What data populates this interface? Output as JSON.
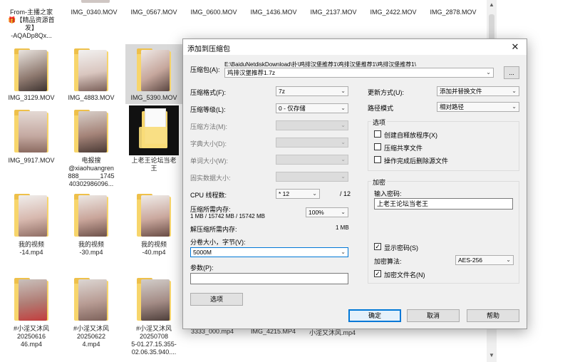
{
  "explorer": {
    "top_tiles": [
      {
        "label": "From-主播之家\n🎁【精品资源首发】\n-AQADp8Qx..."
      },
      {
        "label": "IMG_0340.MOV"
      },
      {
        "label": "IMG_0567.MOV"
      },
      {
        "label": "IMG_0600.MOV"
      },
      {
        "label": "IMG_1436.MOV"
      },
      {
        "label": "IMG_2137.MOV"
      },
      {
        "label": "IMG_2422.MOV"
      },
      {
        "label": "IMG_2878.MOV"
      }
    ],
    "row2": [
      {
        "label": "IMG_3129.MOV"
      },
      {
        "label": "IMG_4883.MOV"
      },
      {
        "label": "IMG_5390.MOV"
      }
    ],
    "row3": [
      {
        "label": "IMG_9917.MOV"
      },
      {
        "label": "电报搜\n@xiaohuangren\n888______1745\n40302986096..."
      },
      {
        "label": "上老王论坛当老\n王"
      }
    ],
    "row4": [
      {
        "label": "我的视频\n-14.mp4"
      },
      {
        "label": "我的视频\n-30.mp4"
      },
      {
        "label": "我的视频\n-40.mp4"
      }
    ],
    "row5": [
      {
        "label": "#小淫又沐风\n20250616\n46.mp4"
      },
      {
        "label": "#小淫又沐风\n20250622\n4.mp4"
      },
      {
        "label": "#小淫又沐风\n20250708\n5-01.27.15.355-\n02.06.35.940...."
      }
    ],
    "bottom_strip": [
      "3333_000.mp4",
      "IMG_4215.MP4",
      "小淫又沐风.mp4"
    ]
  },
  "dialog": {
    "title": "添加到压缩包",
    "close_glyph": "✕",
    "archive_label": "压缩包(A):",
    "archive_path": "E:\\BaiduNetdiskDownload\\扑\\鸡排汉堡推荐1\\鸡排汉堡推荐1\\鸡排汉堡推荐1\\",
    "archive_name": "鸡排汉堡推荐1.7z",
    "browse_label": "...",
    "format_label": "压缩格式(F):",
    "format_value": "7z",
    "level_label": "压缩等级(L):",
    "level_value": "0 - 仅存储",
    "method_label": "压缩方法(M):",
    "dict_label": "字典大小(D):",
    "word_label": "单词大小(W):",
    "solid_label": "固实数据大小:",
    "threads_label": "CPU 线程数:",
    "threads_value": "* 12",
    "threads_max": "/ 12",
    "mem_comp_label": "压缩所需内存:",
    "mem_comp_detail": "1 MB / 15742 MB / 15742 MB",
    "mem_comp_percent": "100%",
    "mem_decomp_label": "解压缩所需内存:",
    "mem_decomp_value": "1 MB",
    "split_label": "分卷大小，字节(V):",
    "split_value": "5000M",
    "params_label": "参数(P):",
    "params_value": "",
    "options_button": "选项",
    "update_label": "更新方式(U):",
    "update_value": "添加并替换文件",
    "path_label": "路径模式",
    "path_value": "相对路径",
    "options_group": "选项",
    "opt_sfx": "创建自释放程序(X)",
    "opt_shared": "压缩共享文件",
    "opt_delete": "操作完成后删除源文件",
    "enc_group": "加密",
    "enc_pwd_label": "输入密码:",
    "enc_pwd_value": "上老王论坛当老王",
    "enc_show": "显示密码(S)",
    "enc_method_label": "加密算法:",
    "enc_method_value": "AES-256",
    "enc_names": "加密文件名(N)",
    "ok": "确定",
    "cancel": "取消",
    "help": "帮助",
    "check_glyph": "✓",
    "combo_arrow": "⌄"
  },
  "colors": {
    "accent": "#0078d7",
    "dialog_bg": "#f0f0f0",
    "folder": "#f7d56b"
  }
}
